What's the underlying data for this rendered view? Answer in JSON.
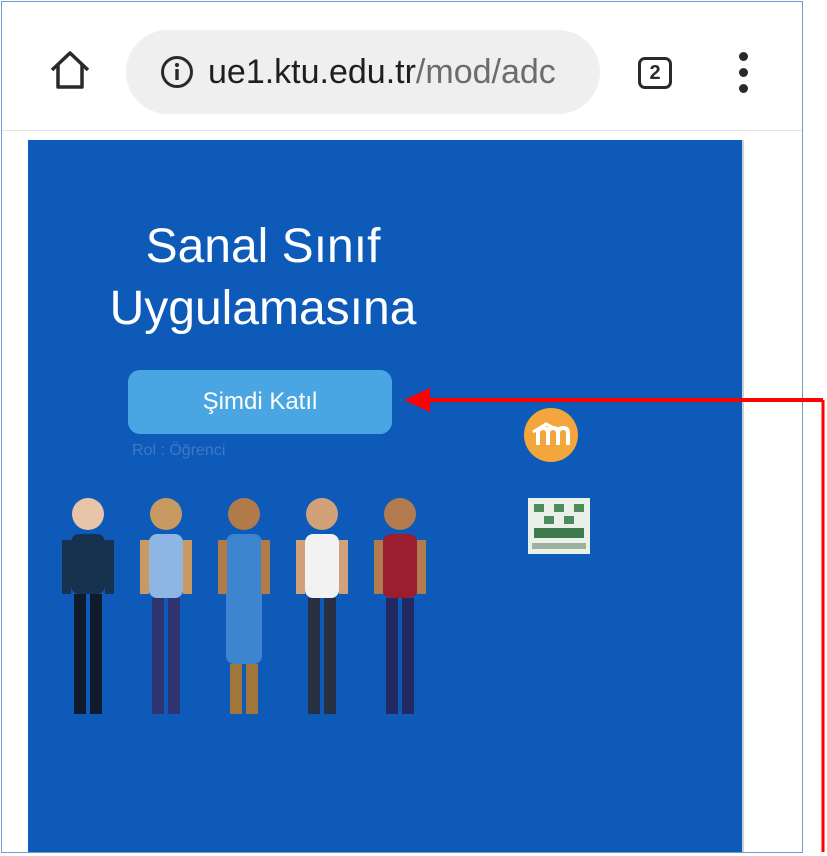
{
  "browser": {
    "url_host": "ue1.ktu.edu.tr",
    "url_path": "/mod/adc",
    "tab_count": "2",
    "icons": [
      "home-icon",
      "info-icon",
      "tabs-icon",
      "overflow-menu-icon"
    ]
  },
  "page": {
    "title_line1": "Sanal Sınıf",
    "title_line2": "Uygulamasına",
    "join_button": "Şimdi Katıl",
    "role_text": "Rol : Öğrenci",
    "background_color": "#0d5ab8",
    "button_color": "#4aa6e2"
  },
  "annotation": {
    "arrow_color": "#ff0000"
  }
}
